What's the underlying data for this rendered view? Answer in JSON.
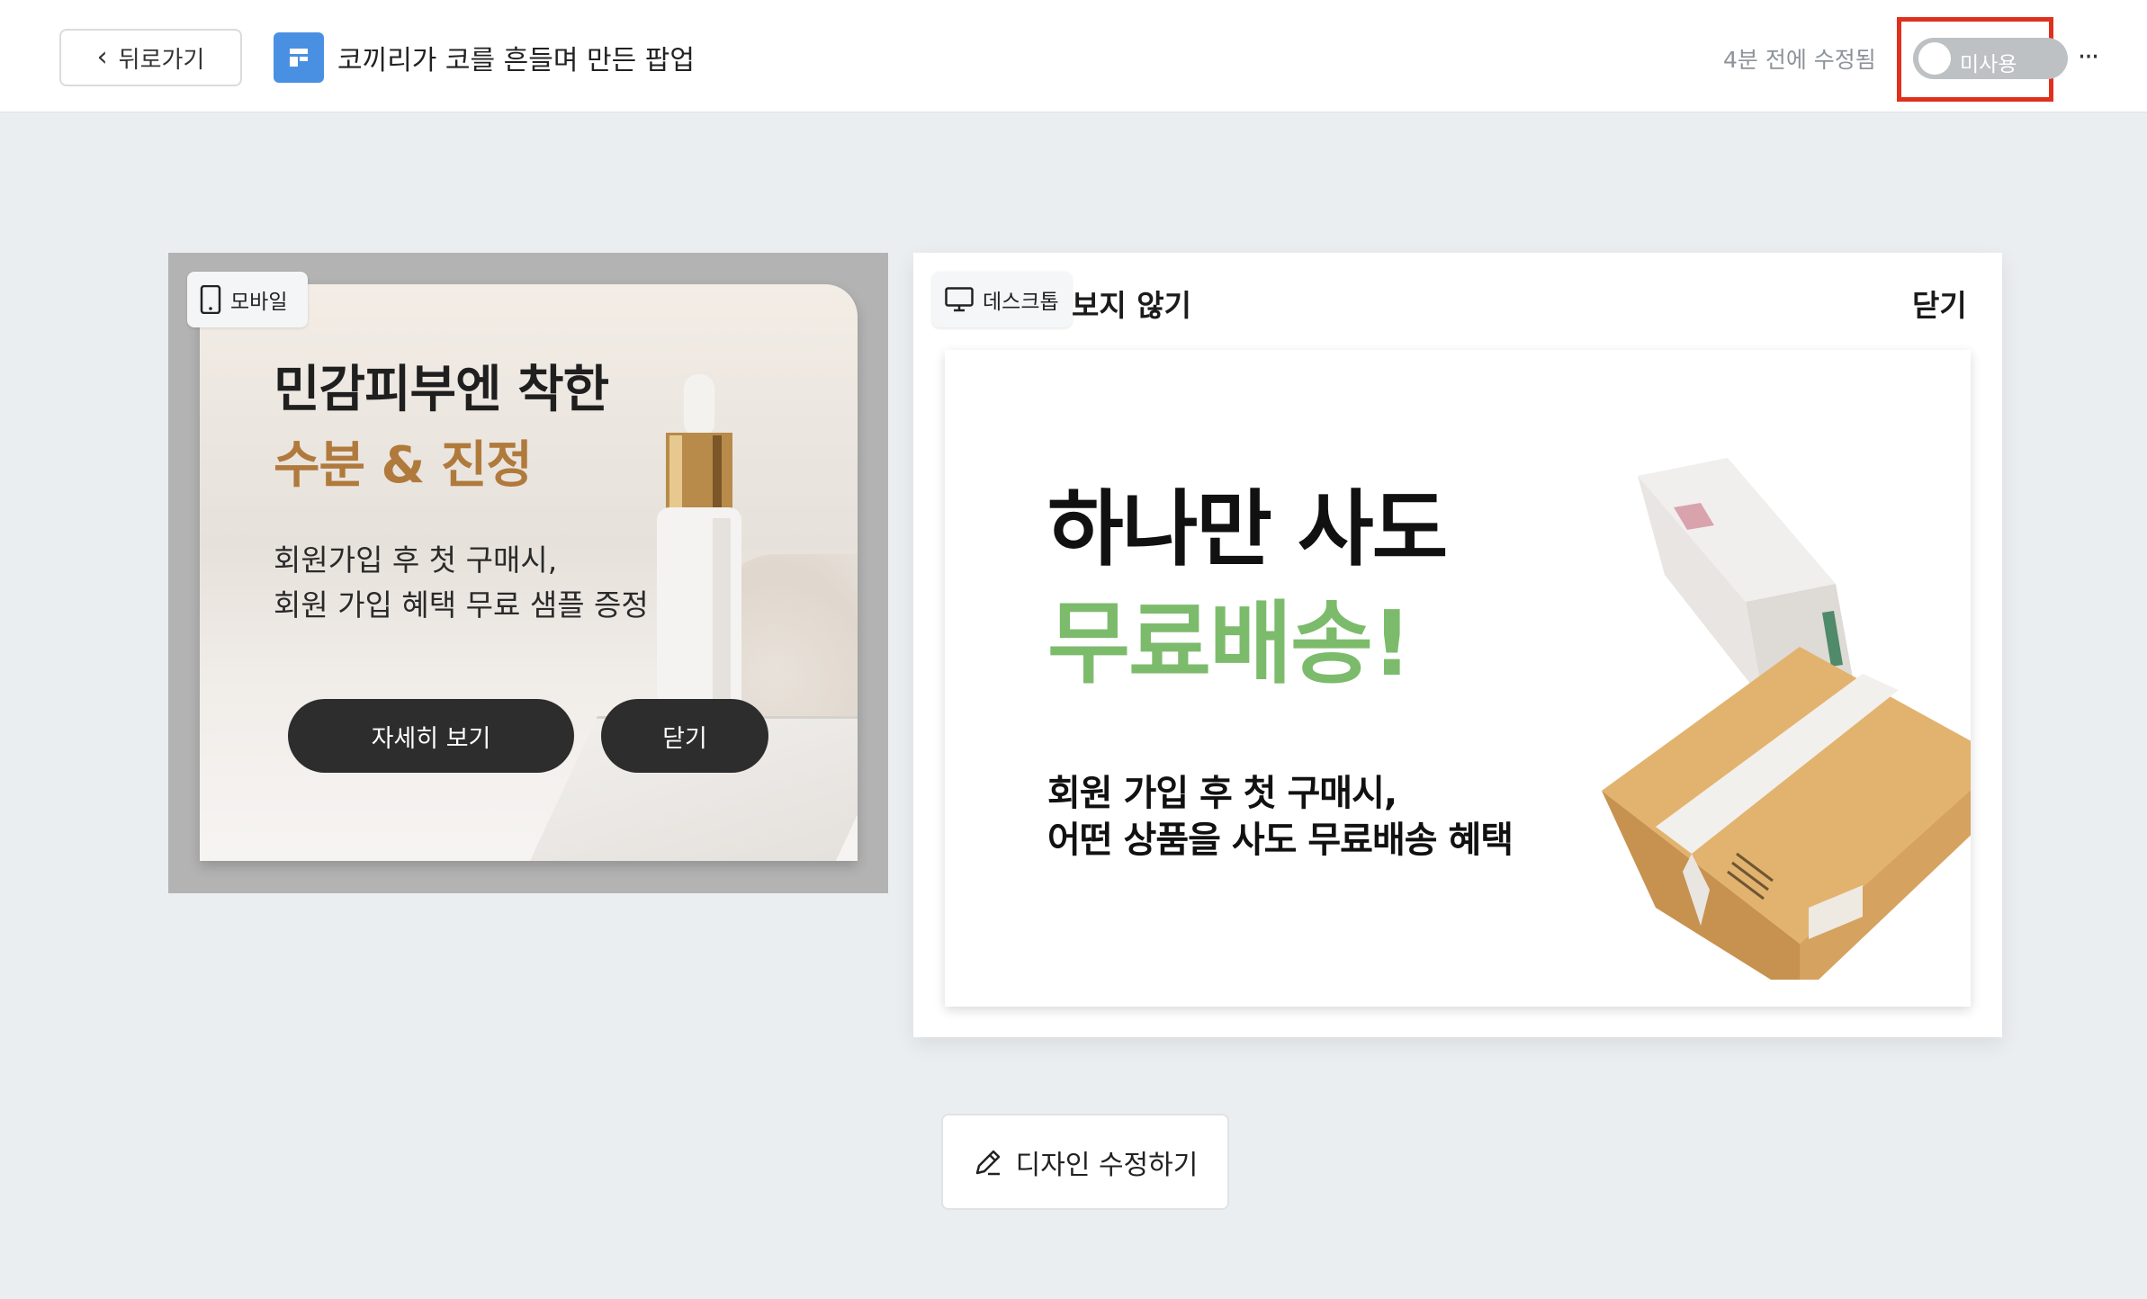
{
  "header": {
    "back_label": "뒤로가기",
    "title": "코끼리가 코를 흔들며 만든 팝업",
    "modified": "4분 전에 수정됨",
    "toggle_label": "미사용",
    "toggle_on": false,
    "more_label": "···",
    "page_icon": "layout-icon",
    "accent_color": "#4a90e2",
    "highlight_color": "#e0301e"
  },
  "mobile": {
    "badge_label": "모바일",
    "badge_icon": "smartphone-icon",
    "title_line1": "민감피부엔 착한",
    "title_line2": "수분 & 진정",
    "title_accent_color": "#b07a3c",
    "body_line1": "회원가입 후 첫 구매시,",
    "body_line2": "회원 가입 혜택 무료 샘플 증정",
    "detail_button": "자세히 보기",
    "close_button": "닫기"
  },
  "desktop": {
    "badge_label": "데스크톱",
    "badge_icon": "monitor-icon",
    "skip_label": "보지 않기",
    "close_label": "닫기",
    "title_line1": "하나만 사도",
    "title_line2": "무료배송!",
    "title_accent_color": "#7cbb6b",
    "body_line1": "회원 가입 후 첫 구매시,",
    "body_line2": "어떤 상품을 사도 무료배송 혜택"
  },
  "footer": {
    "edit_label": "디자인 수정하기",
    "edit_icon": "pencil-icon"
  }
}
